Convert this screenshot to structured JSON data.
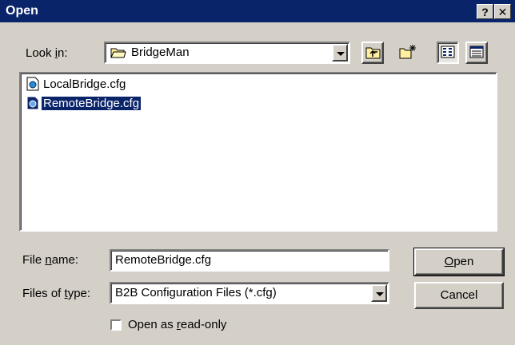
{
  "window": {
    "title": "Open",
    "help_button": "?",
    "close_button": "✕"
  },
  "look_in": {
    "label_pre": "Look ",
    "label_hot": "i",
    "label_post": "n:",
    "value": "BridgeMan"
  },
  "toolbar": {
    "up_one_level": "folder-up-icon",
    "new_folder": "new-folder-icon",
    "list_view": "list-view-icon",
    "details_view": "details-view-icon"
  },
  "files": [
    {
      "name": "LocalBridge.cfg",
      "selected": false,
      "icon": "config-file-icon"
    },
    {
      "name": "RemoteBridge.cfg",
      "selected": true,
      "icon": "config-file-icon"
    }
  ],
  "file_name": {
    "label_pre": "File ",
    "label_hot": "n",
    "label_post": "ame:",
    "value": "RemoteBridge.cfg"
  },
  "file_type": {
    "label_pre": "Files of ",
    "label_hot": "t",
    "label_post": "ype:",
    "value": "B2B Configuration Files (*.cfg)"
  },
  "readonly": {
    "label_pre": "Open as ",
    "label_hot": "r",
    "label_post": "ead-only",
    "checked": false
  },
  "buttons": {
    "open_hot": "O",
    "open_rest": "pen",
    "cancel": "Cancel"
  },
  "colors": {
    "titlebar": "#0a246a",
    "face": "#d4d0c8",
    "selection": "#0a246a"
  }
}
